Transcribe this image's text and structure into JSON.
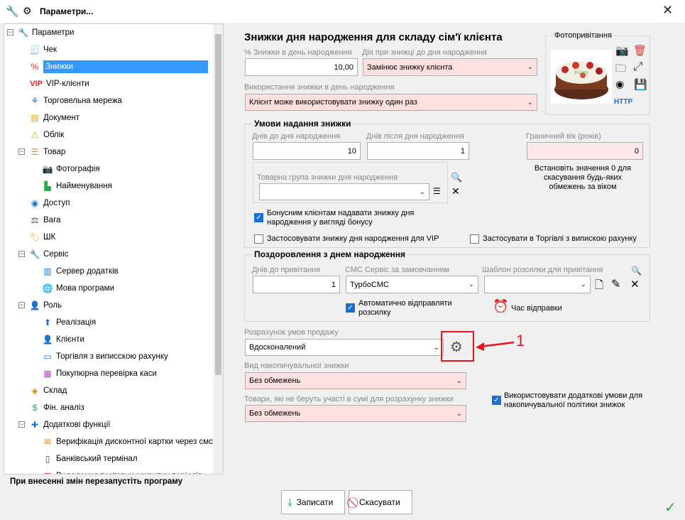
{
  "window": {
    "title": "Параметри..."
  },
  "tree": [
    {
      "label": "Параметри",
      "level": 0,
      "icon": "wrench-icon",
      "expander": "minus"
    },
    {
      "label": "Чек",
      "level": 1,
      "icon": "receipt-icon"
    },
    {
      "label": "Знижки",
      "level": 1,
      "icon": "percent-icon",
      "selected": true
    },
    {
      "label": "VIP-клієнти",
      "level": 1,
      "icon": "vip-icon"
    },
    {
      "label": "Торговельна мережа",
      "level": 1,
      "icon": "network-icon"
    },
    {
      "label": "Документ",
      "level": 1,
      "icon": "document-icon"
    },
    {
      "label": "Облік",
      "level": 1,
      "icon": "warning-icon"
    },
    {
      "label": "Товар",
      "level": 1,
      "icon": "list-icon",
      "expander": "minus"
    },
    {
      "label": "Фотографія",
      "level": 2,
      "icon": "camera-icon"
    },
    {
      "label": "Найменування",
      "level": 2,
      "icon": "tag-green-icon"
    },
    {
      "label": "Доступ",
      "level": 1,
      "icon": "eye-icon"
    },
    {
      "label": "Вага",
      "level": 1,
      "icon": "weight-icon"
    },
    {
      "label": "ШК",
      "level": 1,
      "icon": "barcode-tag-icon"
    },
    {
      "label": "Сервіс",
      "level": 1,
      "icon": "wrench-icon",
      "expander": "minus"
    },
    {
      "label": "Сервер додатків",
      "level": 2,
      "icon": "server-icon"
    },
    {
      "label": "Мова програми",
      "level": 2,
      "icon": "globe-icon"
    },
    {
      "label": "Роль",
      "level": 1,
      "icon": "user-role-icon",
      "expander": "minus"
    },
    {
      "label": "Реалізація",
      "level": 2,
      "icon": "upload-icon"
    },
    {
      "label": "Клієнти",
      "level": 2,
      "icon": "user-icon"
    },
    {
      "label": "Торгівля з виписскою рахунку",
      "level": 2,
      "icon": "invoice-icon"
    },
    {
      "label": "Покупюрна перевірка каси",
      "level": 2,
      "icon": "cash-register-icon"
    },
    {
      "label": "Склад",
      "level": 1,
      "icon": "layers-icon"
    },
    {
      "label": "Фін. аналіз",
      "level": 1,
      "icon": "chart-money-icon"
    },
    {
      "label": "Додаткові функції",
      "level": 1,
      "icon": "puzzle-icon",
      "expander": "minus"
    },
    {
      "label": "Верифікація дисконтної картки через смс",
      "level": 2,
      "icon": "sms-icon"
    },
    {
      "label": "Банківський термінал",
      "level": 2,
      "icon": "terminal-icon"
    },
    {
      "label": "Видалення тестових закритих періодів",
      "level": 2,
      "icon": "calendar-icon"
    }
  ],
  "section_title": "Знижки дня народження для складу сім'ї клієнта",
  "bday": {
    "pct_label": "% Знижки в день народження",
    "pct_value": "10,00",
    "action_label": "Дія при знижці до дня народження",
    "action_value": "Замінює знижку клієнта",
    "usage_label": "Використання знижки в день народження",
    "usage_value": "Клієнт може використовувати знижку один раз"
  },
  "photo": {
    "title": "Фотопривітання",
    "http": "HTTP"
  },
  "conditions": {
    "title": "Умови надання знижки",
    "days_before_label": "Днів до дня народження",
    "days_before_value": "10",
    "days_after_label": "Днів після дня народження",
    "days_after_value": "1",
    "age_label": "Граничний вік (років)",
    "age_value": "0",
    "age_hint": "Встановіть значення 0 для скасування будь-яких обмежень за віком",
    "group_label": "Товарна група знижки дня народження",
    "bonus_checkbox": "Бонусним клієнтам надавати знижку дня народження у вигляді бонусу",
    "vip_checkbox": "Застосовувати знижку дня народження для VIP",
    "invoice_checkbox": "Застосувати в Торгівлі з випискою рахунку"
  },
  "greeting": {
    "title": "Поздоровлення з днем народження",
    "days_label": "Днів до привітання",
    "days_value": "1",
    "sms_label": "СМС Сервіс за замовчанням",
    "sms_value": "ТурбоСМС",
    "template_label": "Шаблон розсилки для привітання",
    "auto_send": "Автоматично відправляти розсилку",
    "send_time": "Час відправки"
  },
  "sale": {
    "calc_label": "Розрахунок умов продажу",
    "calc_value": "Вдосконалений",
    "accum_label": "Вид накопичувальної знижки",
    "accum_value": "Без обмежень",
    "excluded_label": "Товари, які не беруть участі в сумі для розрахунку знижки",
    "excluded_value": "Без обмежень",
    "extra_checkbox": "Використовувати додаткові умови для накопичувальної політики знижок"
  },
  "annotation": {
    "number": "1",
    "color": "#e8141b"
  },
  "footer": {
    "notice": "При внесенні змін перезапустіть програму",
    "save": "Записати",
    "cancel": "Скасувати"
  },
  "colors": {
    "selection": "#3399ff",
    "pink_field": "#ffe0e0",
    "accent_check": "#1a6fd6"
  }
}
